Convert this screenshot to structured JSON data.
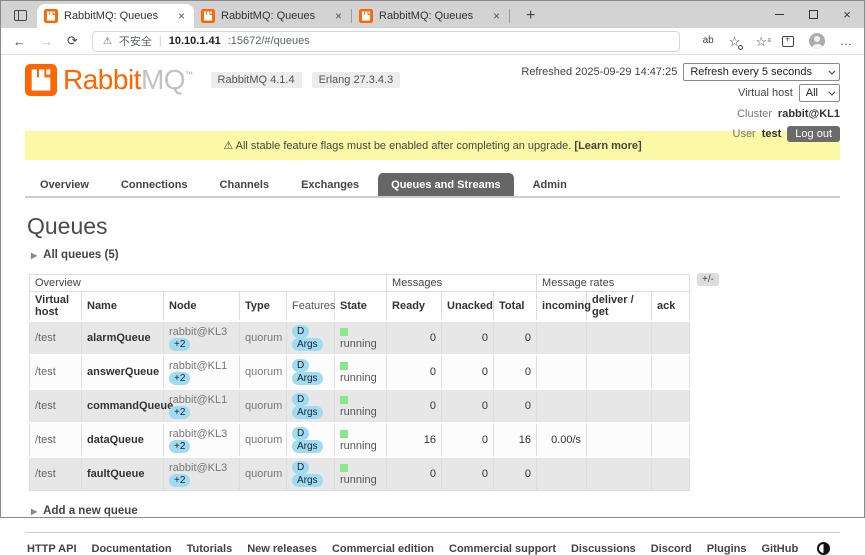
{
  "browser": {
    "tabs": [
      {
        "title": "RabbitMQ: Queues"
      },
      {
        "title": "RabbitMQ: Queues"
      },
      {
        "title": "RabbitMQ: Queues"
      }
    ],
    "address": {
      "security_label": "不安全",
      "host": "10.10.1.41",
      "path": ":15672/#/queues"
    },
    "icons": {
      "warning": "⚠",
      "close": "×",
      "new_tab": "+",
      "back": "←",
      "forward": "→",
      "reload": "⟳",
      "translate": "ab",
      "star": "☆",
      "star_lines": "≡",
      "ellipsis": "…",
      "collapsed_arrow": "▶"
    }
  },
  "header": {
    "logo": {
      "brand": "Rabbit",
      "mq": "MQ",
      "tm": "™"
    },
    "badges": [
      {
        "label": "RabbitMQ 4.1.4"
      },
      {
        "label": "Erlang 27.3.4.3"
      }
    ],
    "refreshed_label": "Refreshed 2025-09-29 14:47:25",
    "refresh_select_value": "Refresh every 5 seconds",
    "vhost_label": "Virtual host",
    "vhost_select_value": "All",
    "cluster_label": "Cluster",
    "cluster_name": "rabbit@KL1",
    "user_label": "User",
    "user_name": "test",
    "logout_label": "Log out"
  },
  "banner": {
    "icon": "⚠",
    "text": "All stable feature flags must be enabled after completing an upgrade.",
    "link": "[Learn more]"
  },
  "nav": {
    "tabs": [
      {
        "label": "Overview",
        "active": false
      },
      {
        "label": "Connections",
        "active": false
      },
      {
        "label": "Channels",
        "active": false
      },
      {
        "label": "Exchanges",
        "active": false
      },
      {
        "label": "Queues and Streams",
        "active": true
      },
      {
        "label": "Admin",
        "active": false
      }
    ]
  },
  "main": {
    "title": "Queues",
    "all_queues_toggle": "All queues (5)",
    "add_queue_toggle": "Add a new queue",
    "plus_minus": "+/-",
    "table": {
      "groups": [
        "Overview",
        "Messages",
        "Message rates"
      ],
      "columns": [
        "Virtual host",
        "Name",
        "Node",
        "Type",
        "Features",
        "State",
        "Ready",
        "Unacked",
        "Total",
        "incoming",
        "deliver / get",
        "ack"
      ],
      "rows": [
        {
          "vhost": "/test",
          "name": "alarmQueue",
          "node": "rabbit@KL3",
          "node_badge": "+2",
          "type": "quorum",
          "features": [
            "D",
            "Args"
          ],
          "state": "running",
          "ready": "0",
          "unacked": "0",
          "total": "0",
          "incoming": "",
          "deliver_get": "",
          "ack": ""
        },
        {
          "vhost": "/test",
          "name": "answerQueue",
          "node": "rabbit@KL1",
          "node_badge": "+2",
          "type": "quorum",
          "features": [
            "D",
            "Args"
          ],
          "state": "running",
          "ready": "0",
          "unacked": "0",
          "total": "0",
          "incoming": "",
          "deliver_get": "",
          "ack": ""
        },
        {
          "vhost": "/test",
          "name": "commandQueue",
          "node": "rabbit@KL1",
          "node_badge": "+2",
          "type": "quorum",
          "features": [
            "D",
            "Args"
          ],
          "state": "running",
          "ready": "0",
          "unacked": "0",
          "total": "0",
          "incoming": "",
          "deliver_get": "",
          "ack": ""
        },
        {
          "vhost": "/test",
          "name": "dataQueue",
          "node": "rabbit@KL3",
          "node_badge": "+2",
          "type": "quorum",
          "features": [
            "D",
            "Args"
          ],
          "state": "running",
          "ready": "16",
          "unacked": "0",
          "total": "16",
          "incoming": "0.00/s",
          "deliver_get": "",
          "ack": ""
        },
        {
          "vhost": "/test",
          "name": "faultQueue",
          "node": "rabbit@KL3",
          "node_badge": "+2",
          "type": "quorum",
          "features": [
            "D",
            "Args"
          ],
          "state": "running",
          "ready": "0",
          "unacked": "0",
          "total": "0",
          "incoming": "",
          "deliver_get": "",
          "ack": ""
        }
      ]
    }
  },
  "footer": {
    "links": [
      "HTTP API",
      "Documentation",
      "Tutorials",
      "New releases",
      "Commercial edition",
      "Commercial support",
      "Discussions",
      "Discord",
      "Plugins",
      "GitHub"
    ]
  },
  "colors": {
    "brand_orange": "#ff6600",
    "banner_yellow": "#fbf9a6",
    "active_tab_gray": "#666666",
    "feature_badge_blue": "#9fdcf2",
    "state_green": "#8ae88a"
  }
}
